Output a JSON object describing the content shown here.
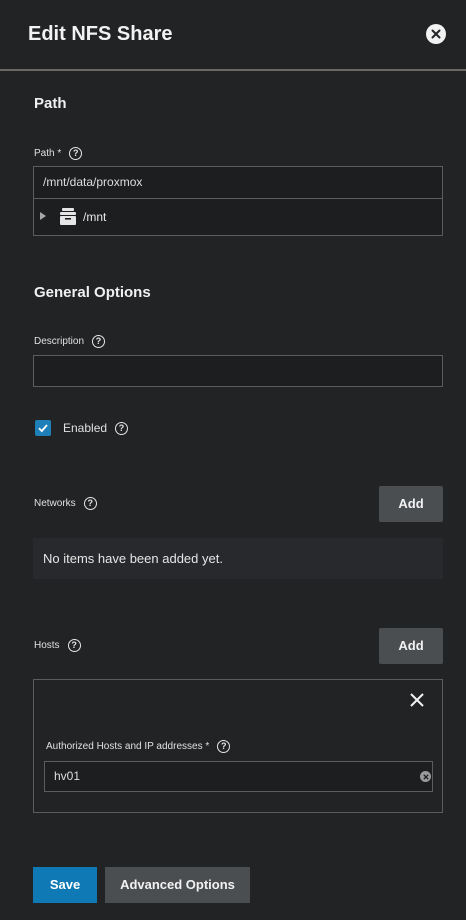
{
  "header": {
    "title": "Edit NFS Share",
    "close_icon": "close-circle-icon"
  },
  "path_section": {
    "title": "Path",
    "field_label": "Path *",
    "value": "/mnt/data/proxmox",
    "tree": {
      "item": "/mnt",
      "icon": "dataset-folder-icon"
    }
  },
  "general_section": {
    "title": "General Options",
    "description_label": "Description",
    "description_value": "",
    "enabled_label": "Enabled",
    "enabled_checked": true
  },
  "networks": {
    "label": "Networks",
    "add_label": "Add",
    "empty_text": "No items have been added yet."
  },
  "hosts": {
    "label": "Hosts",
    "add_label": "Add",
    "entry_label": "Authorized Hosts and IP addresses *",
    "entry_value": "hv01"
  },
  "footer": {
    "save_label": "Save",
    "advanced_label": "Advanced Options"
  },
  "colors": {
    "accent": "#0f79b6",
    "background": "#212325",
    "button": "#4b4e51"
  }
}
